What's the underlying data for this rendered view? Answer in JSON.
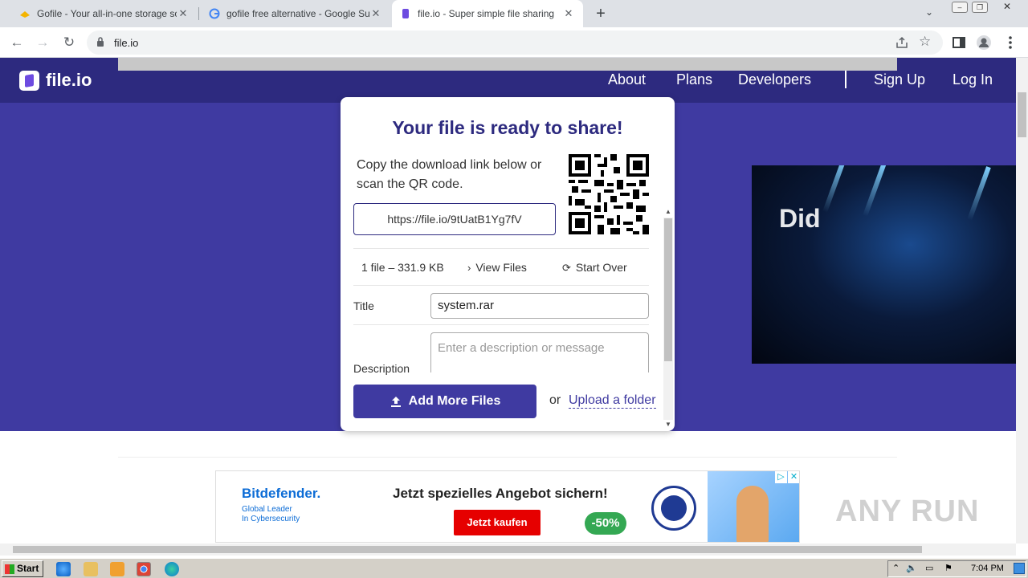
{
  "browser": {
    "tabs": [
      {
        "title": "Gofile - Your all-in-one storage soluti",
        "active": false
      },
      {
        "title": "gofile free alternative - Google Suche",
        "active": false
      },
      {
        "title": "file.io - Super simple file sharing",
        "active": true
      }
    ],
    "url": "file.io"
  },
  "site": {
    "logo": "file.io",
    "nav": [
      "About",
      "Plans",
      "Developers",
      "Sign Up",
      "Log In"
    ]
  },
  "card": {
    "title": "Your file is ready to share!",
    "copy_text": "Copy the download link below or scan the QR code.",
    "link": "https://file.io/9tUatB1Yg7fV",
    "file_info": "1 file – 331.9 KB",
    "view_files": "View Files",
    "start_over": "Start Over",
    "title_label": "Title",
    "title_value": "system.rar",
    "description_label": "Description",
    "description_placeholder": "Enter a description or message",
    "add_more": "Add More Files",
    "or": "or",
    "upload_folder": "Upload a folder"
  },
  "ads": {
    "video_text": "Did",
    "brand": "Bitdefender.",
    "tagline_1": "Global Leader",
    "tagline_2": "In Cybersecurity",
    "headline": "Jetzt spezielles Angebot sichern!",
    "cta": "Jetzt kaufen",
    "discount": "-50%"
  },
  "watermark": "ANY RUN",
  "taskbar": {
    "start": "Start",
    "time": "7:04 PM"
  },
  "colors": {
    "brand_dark": "#2d2a7f",
    "brand": "#3f3aa1"
  }
}
